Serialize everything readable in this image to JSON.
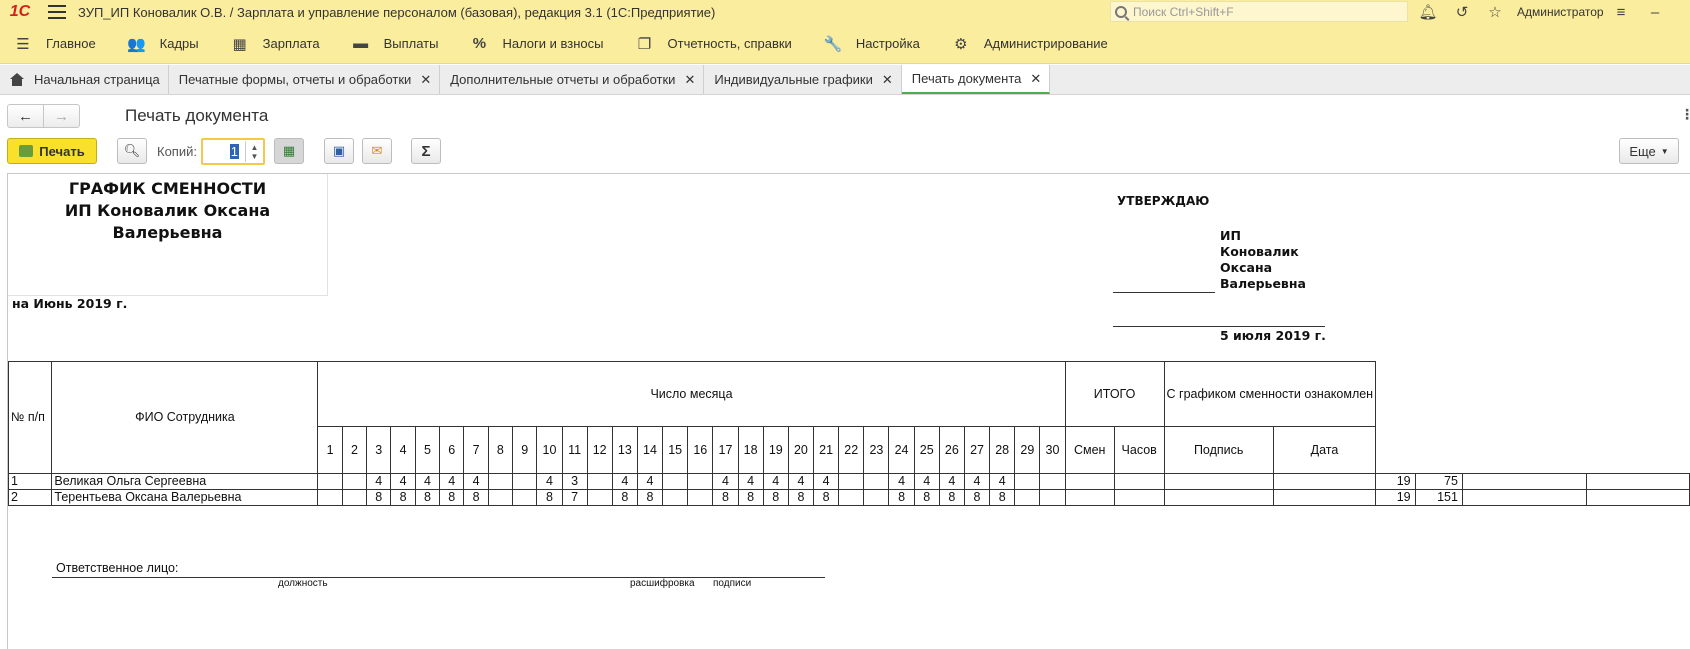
{
  "titlebar": {
    "logo": "1С",
    "title": "ЗУП_ИП Коновалик О.В. / Зарплата и управление персоналом (базовая), редакция 3.1  (1С:Предприятие)",
    "search_placeholder": "Поиск Ctrl+Shift+F",
    "user": "Администратор"
  },
  "menu": [
    {
      "label": "Главное",
      "icon": "☰"
    },
    {
      "label": "Кадры",
      "icon": "👥"
    },
    {
      "label": "Зарплата",
      "icon": "▦"
    },
    {
      "label": "Выплаты",
      "icon": "▬"
    },
    {
      "label": "Налоги и взносы",
      "icon": "%"
    },
    {
      "label": "Отчетность, справки",
      "icon": "❐"
    },
    {
      "label": "Настройка",
      "icon": "🔧"
    },
    {
      "label": "Администрирование",
      "icon": "⚙"
    }
  ],
  "tabs": [
    {
      "label": "Начальная страница",
      "closable": false
    },
    {
      "label": "Печатные формы, отчеты и обработки",
      "closable": true
    },
    {
      "label": "Дополнительные отчеты и обработки",
      "closable": true
    },
    {
      "label": "Индивидуальные графики",
      "closable": true
    },
    {
      "label": "Печать документа",
      "closable": true,
      "active": true
    }
  ],
  "form": {
    "title": "Печать документа",
    "print_label": "Печать",
    "copies_label": "Копий:",
    "copies_value": "1",
    "more_label": "Еще"
  },
  "document": {
    "title_lines": [
      "ГРАФИК СМЕННОСТИ",
      "ИП Коновалик Оксана",
      "Валерьевна"
    ],
    "period": "на Июнь 2019 г.",
    "approve": "УТВЕРЖДАЮ",
    "approver_lines": [
      "ИП",
      "Коновалик",
      "Оксана",
      "Валерьевна"
    ],
    "approve_date": "5 июля 2019 г.",
    "headers": {
      "num": "№ п/п",
      "fio": "ФИО Сотрудника",
      "days_group": "Число месяца",
      "itogo": "ИТОГО",
      "familiar": "С графиком сменности ознакомлен",
      "shifts": "Смен",
      "hours": "Часов",
      "sign": "Подпись",
      "date": "Дата"
    },
    "days": [
      "1",
      "2",
      "3",
      "4",
      "5",
      "6",
      "7",
      "8",
      "9",
      "10",
      "11",
      "12",
      "13",
      "14",
      "15",
      "16",
      "17",
      "18",
      "19",
      "20",
      "21",
      "22",
      "23",
      "24",
      "25",
      "26",
      "27",
      "28",
      "29",
      "30"
    ],
    "rows": [
      {
        "num": "1",
        "fio": "Великая Ольга Сергеевна",
        "days": [
          "",
          "",
          "4",
          "4",
          "4",
          "4",
          "4",
          "",
          "",
          "4",
          "3",
          "",
          "4",
          "4",
          "",
          "",
          "4",
          "4",
          "4",
          "4",
          "4",
          "",
          "",
          "4",
          "4",
          "4",
          "4",
          "4",
          "",
          ""
        ],
        "shifts": "19",
        "hours": "75"
      },
      {
        "num": "2",
        "fio": "Терентьева Оксана Валерьевна",
        "days": [
          "",
          "",
          "8",
          "8",
          "8",
          "8",
          "8",
          "",
          "",
          "8",
          "7",
          "",
          "8",
          "8",
          "",
          "",
          "8",
          "8",
          "8",
          "8",
          "8",
          "",
          "",
          "8",
          "8",
          "8",
          "8",
          "8",
          "",
          ""
        ],
        "shifts": "19",
        "hours": "151"
      }
    ],
    "responsible": "Ответственное лицо:",
    "cap_position": "должность",
    "cap_decode": "расшифровка",
    "cap_sign": "подписи"
  }
}
